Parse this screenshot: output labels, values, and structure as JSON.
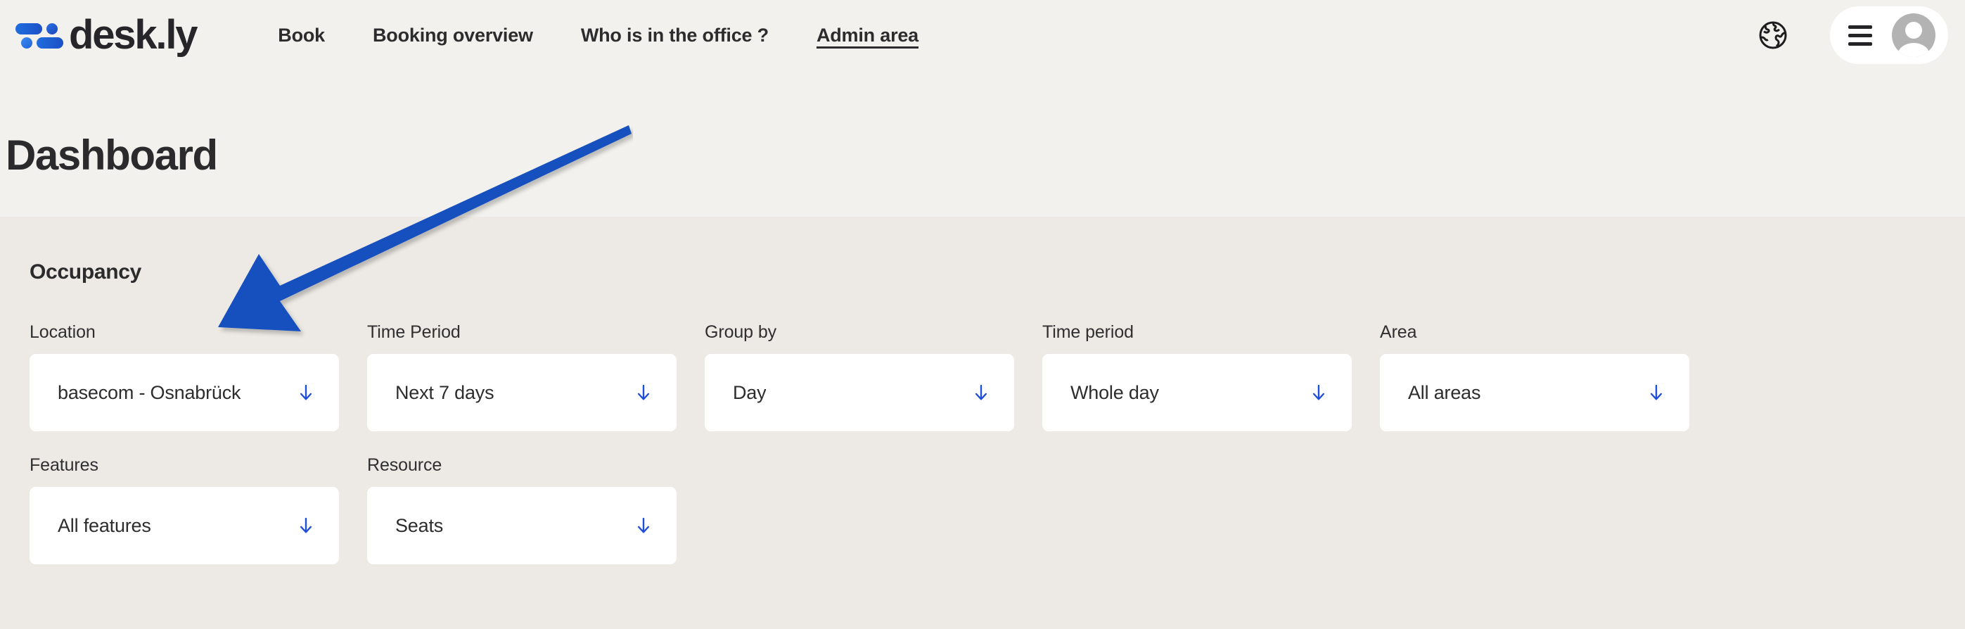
{
  "brand": {
    "name": "desk.ly",
    "logo_icon": "deskly-logo-icon"
  },
  "nav": {
    "items": [
      {
        "label": "Book",
        "active": false
      },
      {
        "label": "Booking overview",
        "active": false
      },
      {
        "label": "Who is in the office ?",
        "active": false
      },
      {
        "label": "Admin area",
        "active": true
      }
    ]
  },
  "header_right": {
    "globe_icon": "globe-icon",
    "menu_icon": "hamburger-menu-icon",
    "avatar_icon": "user-avatar-icon"
  },
  "page": {
    "title": "Dashboard"
  },
  "panel": {
    "title": "Occupancy",
    "filters": [
      {
        "label": "Location",
        "value": "basecom - Osnabrück",
        "arrow": "arrow-down-icon"
      },
      {
        "label": "Time Period",
        "value": "Next 7 days",
        "arrow": "arrow-down-icon"
      },
      {
        "label": "Group by",
        "value": "Day",
        "arrow": "arrow-down-icon"
      },
      {
        "label": "Time period",
        "value": "Whole day",
        "arrow": "arrow-down-icon"
      },
      {
        "label": "Area",
        "value": "All areas",
        "arrow": "arrow-down-icon"
      },
      {
        "label": "Features",
        "value": "All features",
        "arrow": "arrow-down-icon"
      },
      {
        "label": "Resource",
        "value": "Seats",
        "arrow": "arrow-down-icon"
      }
    ]
  },
  "annotation": {
    "type": "arrow-annotation",
    "direction": "down-left",
    "color": "#1450BE"
  },
  "colors": {
    "page_background": "#F2F1ED",
    "panel_background": "#EDEAE5",
    "field_background": "#FFFFFF",
    "text": "#2B2B2D",
    "accent_blue": "#1B4FC4",
    "annotation_blue": "#1450BE"
  }
}
